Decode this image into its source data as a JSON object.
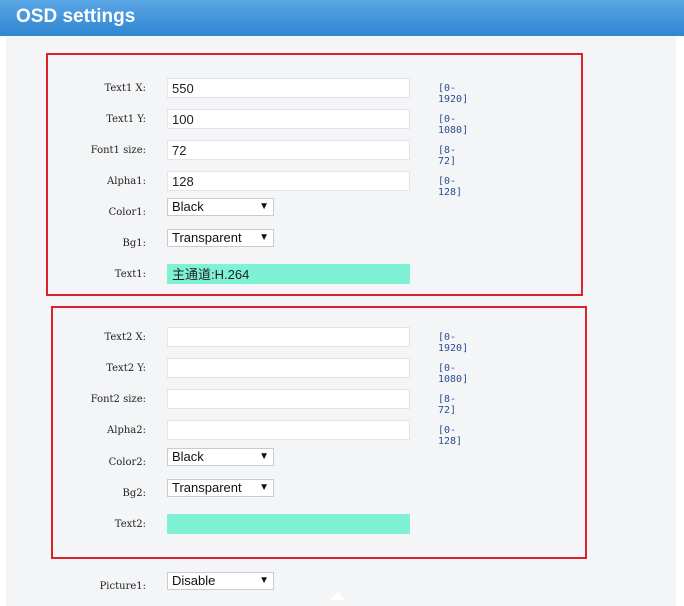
{
  "header": {
    "title": "OSD settings"
  },
  "section1": {
    "text_x": {
      "label": "Text1 X:",
      "value": "550",
      "range": "[0-1920]"
    },
    "text_y": {
      "label": "Text1 Y:",
      "value": "100",
      "range": "[0-1080]"
    },
    "font_size": {
      "label": "Font1 size:",
      "value": "72",
      "range": "[8-72]"
    },
    "alpha": {
      "label": "Alpha1:",
      "value": "128",
      "range": "[0-128]"
    },
    "color": {
      "label": "Color1:",
      "value": "Black"
    },
    "bg": {
      "label": "Bg1:",
      "value": "Transparent"
    },
    "text": {
      "label": "Text1:",
      "value": "主通道:H.264"
    }
  },
  "section2": {
    "text_x": {
      "label": "Text2 X:",
      "value": "",
      "range": "[0-1920]"
    },
    "text_y": {
      "label": "Text2 Y:",
      "value": "",
      "range": "[0-1080]"
    },
    "font_size": {
      "label": "Font2 size:",
      "value": "",
      "range": "[8-72]"
    },
    "alpha": {
      "label": "Alpha2:",
      "value": "",
      "range": "[0-128]"
    },
    "color": {
      "label": "Color2:",
      "value": "Black"
    },
    "bg": {
      "label": "Bg2:",
      "value": "Transparent"
    },
    "text": {
      "label": "Text2:",
      "value": ""
    }
  },
  "picture": {
    "label": "Picture1:",
    "value": "Disable"
  },
  "colors": {
    "header_blue": "#3a8ed5",
    "highlight_border": "#d8232a",
    "text_field_bg": "#7ff2d6",
    "range_text": "#2a4d8f"
  },
  "icons": {
    "dropdown": "chevron-down-icon"
  }
}
